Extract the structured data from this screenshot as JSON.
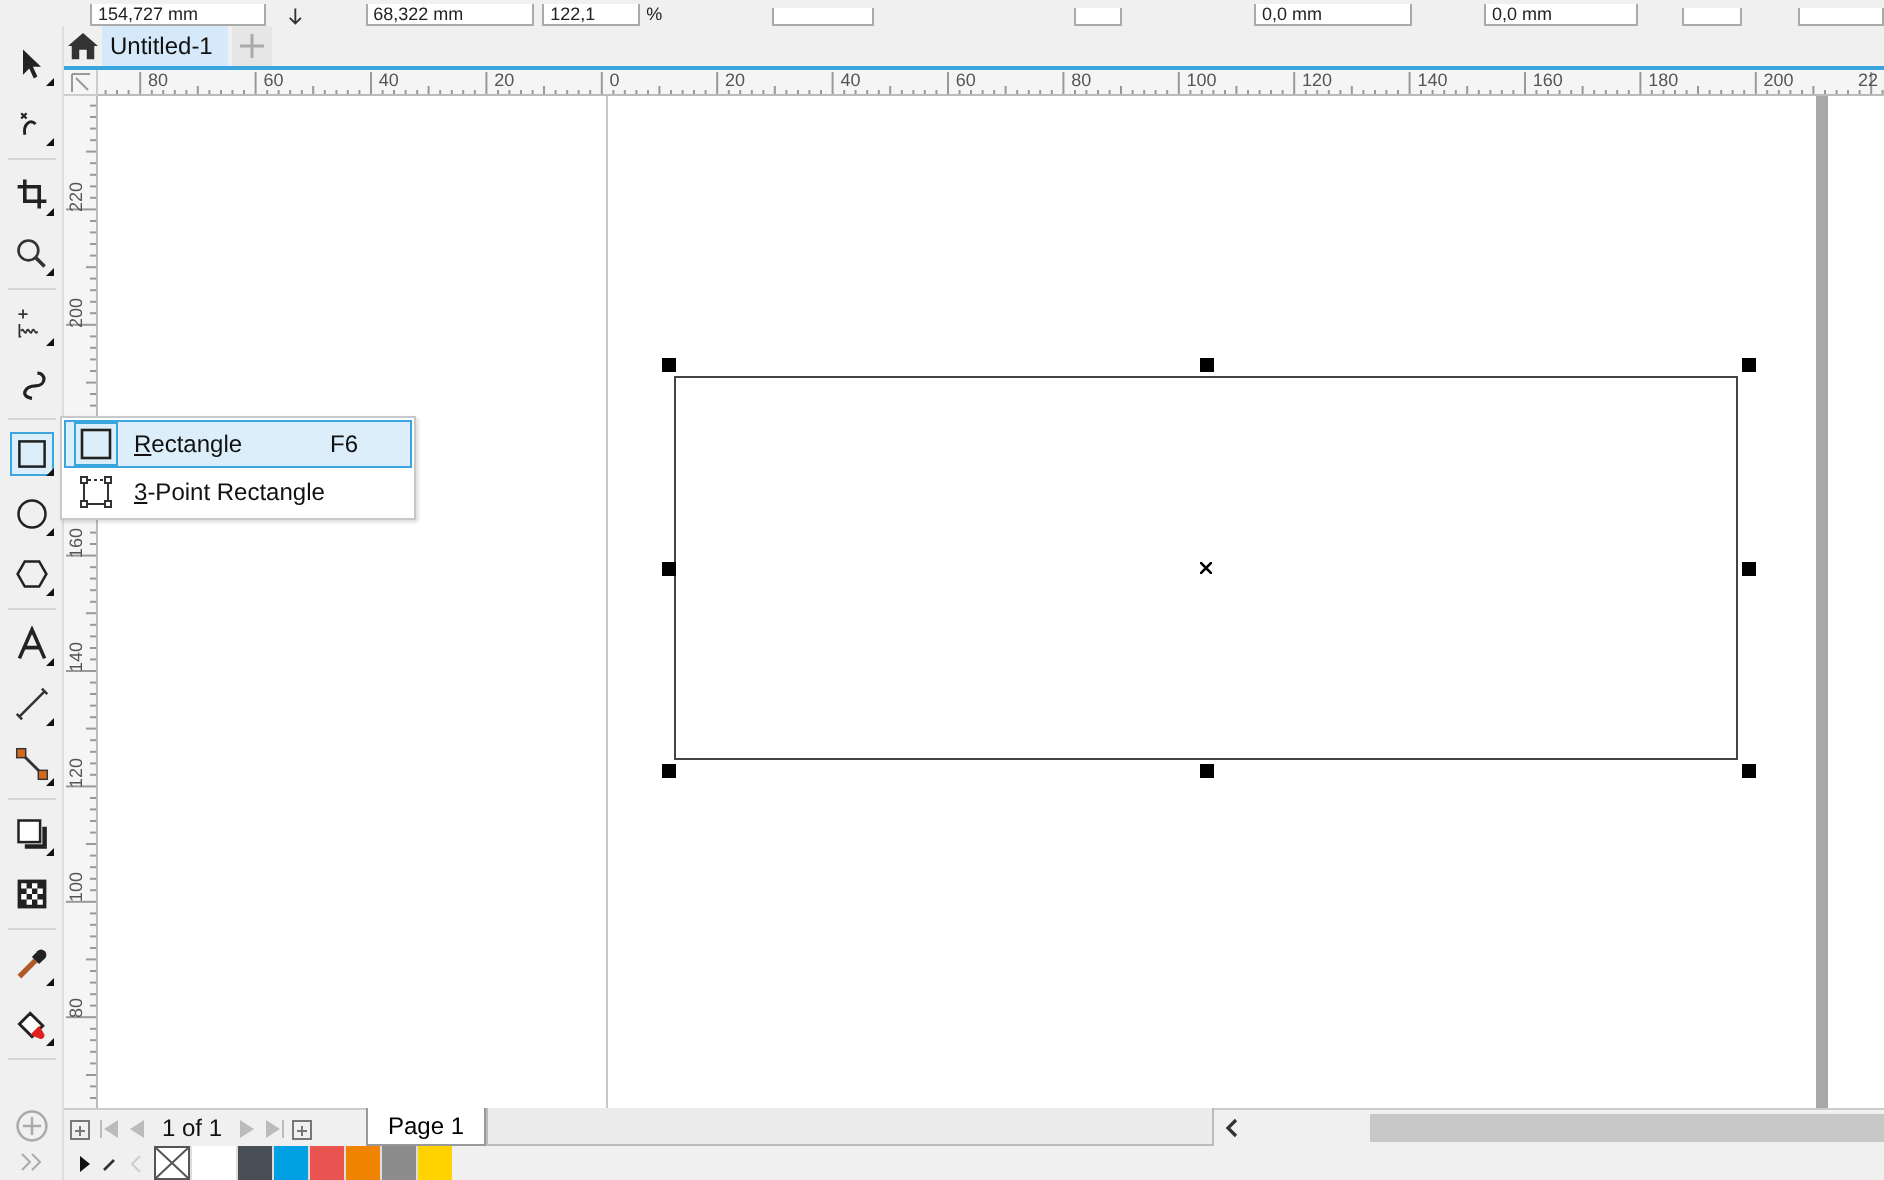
{
  "property_bar": {
    "fields": [
      {
        "value": "154,727 mm"
      },
      {
        "value": "68,322 mm"
      },
      {
        "value": "122,1",
        "unit": "%"
      },
      {
        "value": "0,0 mm"
      },
      {
        "value": "0,0 mm"
      }
    ]
  },
  "document_tabs": [
    {
      "label": "Untitled-1",
      "selected": true
    }
  ],
  "toolbox": {
    "tools": [
      {
        "selected": false
      },
      {
        "selected": false
      },
      {
        "selected": false
      },
      {
        "selected": false
      },
      {
        "selected": false
      },
      {
        "selected": false
      },
      {
        "selected": true
      },
      {
        "selected": false
      },
      {
        "selected": false
      },
      {
        "selected": false
      },
      {
        "selected": false
      },
      {
        "selected": false
      },
      {
        "selected": false
      },
      {
        "selected": false
      },
      {
        "selected": false
      },
      {
        "selected": false
      }
    ]
  },
  "ruler_h": {
    "labels": [
      "80",
      "60",
      "40",
      "20",
      "0",
      "20",
      "40",
      "60",
      "80",
      "100",
      "120",
      "140",
      "160",
      "180",
      "200",
      "22"
    ]
  },
  "ruler_v": {
    "labels": [
      "220",
      "200",
      "160",
      "140",
      "120",
      "100",
      "80"
    ]
  },
  "flyout": {
    "items": [
      {
        "label": "Rectangle",
        "shortcut": "F6",
        "selected": true
      },
      {
        "label": "3-Point Rectangle",
        "selected": false
      }
    ]
  },
  "page_nav": {
    "counter": "1 of 1",
    "pages": [
      {
        "label": "Page 1",
        "selected": true
      }
    ]
  },
  "palette": {
    "swatches": [
      {
        "color": "#ffffff"
      },
      {
        "color": "#474e55"
      },
      {
        "color": "#00a0e3"
      },
      {
        "color": "#e95350"
      },
      {
        "color": "#f08300"
      },
      {
        "color": "#8c8c8c"
      },
      {
        "color": "#ffd200"
      }
    ]
  }
}
